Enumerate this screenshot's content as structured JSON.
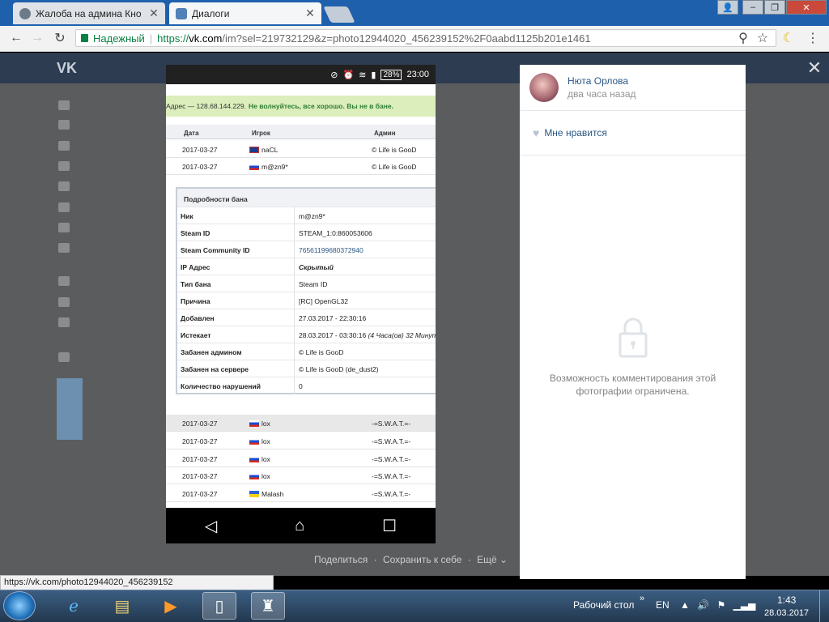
{
  "browser": {
    "tabs": [
      {
        "label": "Жалоба на админа Кно"
      },
      {
        "label": "Диалоги"
      }
    ],
    "secure_label": "Надежный",
    "url_scheme": "https://",
    "url_host": "vk.com",
    "url_rest": "/im?sel=219732129&z=photo12944020_456239152%2F0aabd1125b201e1461",
    "status_url": "https://vk.com/photo12944020_456239152"
  },
  "photo": {
    "status": {
      "battery": "28%",
      "time": "23:00"
    },
    "notice_prefix": "Адрес — 128.68.144.229.",
    "notice_bold": "Не волнуйтесь, все хорошо. Вы не в бане.",
    "table_headers": {
      "date": "Дата",
      "player": "Игрок",
      "admin": "Админ"
    },
    "top_rows": [
      {
        "date": "2017-03-27",
        "player": "naCL",
        "admin": "© Life is GooD",
        "flag": "gb"
      },
      {
        "date": "2017-03-27",
        "player": "m@zn9*",
        "admin": "© Life is GooD",
        "flag": "ru"
      }
    ],
    "details": {
      "title": "Подробности бана",
      "rows": [
        {
          "k": "Ник",
          "v": "m@zn9*"
        },
        {
          "k": "Steam ID",
          "v": "STEAM_1:0:860053606"
        },
        {
          "k": "Steam Community ID",
          "v": "76561199680372940"
        },
        {
          "k": "IP Адрес",
          "v": "Скрытый"
        },
        {
          "k": "Тип бана",
          "v": "Steam ID"
        },
        {
          "k": "Причина",
          "v": "[RC] OpenGL32"
        },
        {
          "k": "Добавлен",
          "v": "27.03.2017 - 22:30:16"
        },
        {
          "k": "Истекает",
          "v": "28.03.2017 - 03:30:16",
          "v2": "(4 Часа(ов) 32 Минут"
        },
        {
          "k": "Забанен админом",
          "v": "© Life is GooD"
        },
        {
          "k": "Забанен на сервере",
          "v": "© Life is GooD (de_dust2)"
        },
        {
          "k": "Количество нарушений",
          "v": "0"
        }
      ]
    },
    "bottom_rows": [
      {
        "date": "2017-03-27",
        "player": "lox",
        "admin": "-=S.W.A.T.=-",
        "flag": "ru"
      },
      {
        "date": "2017-03-27",
        "player": "lox",
        "admin": "-=S.W.A.T.=-",
        "flag": "ru"
      },
      {
        "date": "2017-03-27",
        "player": "lox",
        "admin": "-=S.W.A.T.=-",
        "flag": "ru"
      },
      {
        "date": "2017-03-27",
        "player": "lox",
        "admin": "-=S.W.A.T.=-",
        "flag": "ru"
      },
      {
        "date": "2017-03-27",
        "player": "Malash",
        "admin": "-=S.W.A.T.=-",
        "flag": "ua"
      }
    ]
  },
  "photo_actions": {
    "share": "Поделиться",
    "save": "Сохранить к себе",
    "more": "Ещё"
  },
  "panel": {
    "author_name": "Нюта Орлова",
    "post_time": "два часа назад",
    "like_label": "Мне нравится",
    "restriction_text": "Возможность комментирования этой фотографии ограничена."
  },
  "taskbar": {
    "desktop_label": "Рабочий стол",
    "lang": "EN",
    "time": "1:43",
    "date": "28.03.2017"
  }
}
